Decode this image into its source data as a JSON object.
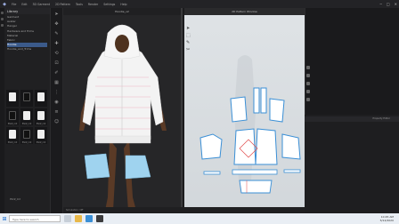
{
  "app": {
    "menu": [
      "File",
      "Edit",
      "3D Garment",
      "2D Pattern",
      "Tools",
      "Render",
      "Settings",
      "Help"
    ],
    "window_controls": [
      "─",
      "□",
      "✕"
    ]
  },
  "library": {
    "title": "Library",
    "tree": [
      "Garment",
      "Avatar",
      "Hanger",
      "Hardware and Trims",
      "Material",
      "Fabric",
      "Hoodie",
      "Hoodie_and_Trims"
    ],
    "selected_index": 6,
    "thumbs": [
      {
        "caption": "",
        "dark": false
      },
      {
        "caption": "",
        "dark": true
      },
      {
        "caption": "",
        "dark": false
      },
      {
        "caption": "PSCZ_mit",
        "dark": true
      },
      {
        "caption": "PSCZ_mit",
        "dark": false
      },
      {
        "caption": "PSCZ_mit",
        "dark": false
      },
      {
        "caption": "PSCZ_mit",
        "dark": false
      },
      {
        "caption": "PSCZ_mit",
        "dark": true
      },
      {
        "caption": "PSCZ_mit",
        "dark": false
      }
    ],
    "last_label": "PSCZ_mit"
  },
  "view3d": {
    "title": "Hoodie_v2"
  },
  "view2d": {
    "title": "2D Pattern Window"
  },
  "right_panel": {
    "tab": "Property Editor"
  },
  "status": {
    "text": "Simulation: Off"
  },
  "taskbar": {
    "search_placeholder": "Type here to search",
    "time": "10:45 AM",
    "date": "5/12/2020"
  },
  "colors": {
    "accent": "#3b5a8a",
    "pattern_outline": "#3a8fd6",
    "sleeve_piece": "#9fd3ef",
    "seam": "#e04848"
  }
}
